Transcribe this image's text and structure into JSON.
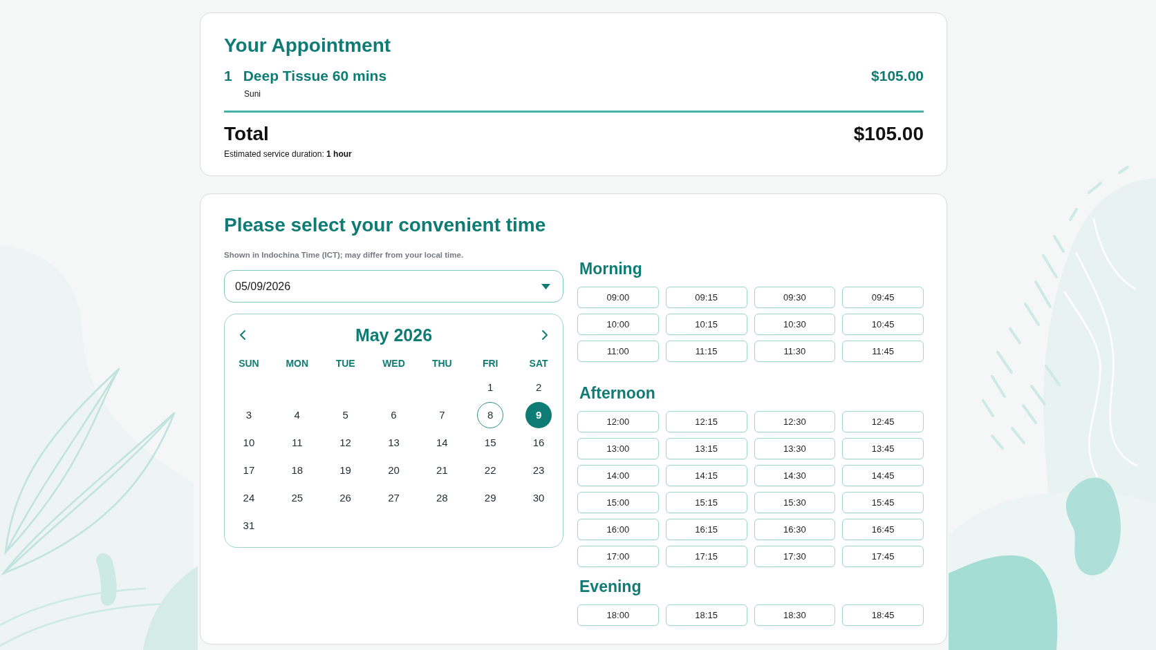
{
  "appointment": {
    "title": "Your Appointment",
    "items": [
      {
        "number": "1",
        "name": "Deep Tissue 60 mins",
        "staff": "Suni",
        "price": "$105.00"
      }
    ],
    "total": {
      "label": "Total",
      "amount": "$105.00",
      "duration_note": "Estimated service duration: **1 hour**"
    }
  },
  "booking": {
    "title": "Please select your convenient time",
    "timezone_note": "Shown in Indochina Time (ICT); may differ from your local time.",
    "date_field": {
      "value": "05/09/2026"
    },
    "calendar": {
      "month": "May 2026",
      "weekdays": [
        "SUN",
        "MON",
        "TUE",
        "WED",
        "THU",
        "FRI",
        "SAT"
      ],
      "weeks": [
        [
          {
            "day": "1",
            "selected": false,
            "today": false
          },
          {
            "day": "2",
            "selected": false,
            "today": false
          }
        ],
        [
          {
            "day": "3",
            "selected": false,
            "today": false
          },
          {
            "day": "4",
            "selected": false,
            "today": false
          },
          {
            "day": "5",
            "selected": false,
            "today": false
          },
          {
            "day": "6",
            "selected": false,
            "today": false
          },
          {
            "day": "7",
            "selected": false,
            "today": false
          },
          {
            "day": "8",
            "selected": false,
            "today": true
          },
          {
            "day": "9",
            "selected": true,
            "today": false
          }
        ],
        [
          {
            "day": "10",
            "selected": false,
            "today": false
          },
          {
            "day": "11",
            "selected": false,
            "today": false
          },
          {
            "day": "12",
            "selected": false,
            "today": false
          },
          {
            "day": "13",
            "selected": false,
            "today": false
          },
          {
            "day": "14",
            "selected": false,
            "today": false
          },
          {
            "day": "15",
            "selected": false,
            "today": false
          },
          {
            "day": "16",
            "selected": false,
            "today": false
          }
        ],
        [
          {
            "day": "17",
            "selected": false,
            "today": false
          },
          {
            "day": "18",
            "selected": false,
            "today": false
          },
          {
            "day": "19",
            "selected": false,
            "today": false
          },
          {
            "day": "20",
            "selected": false,
            "today": false
          },
          {
            "day": "21",
            "selected": false,
            "today": false
          },
          {
            "day": "22",
            "selected": false,
            "today": false
          },
          {
            "day": "23",
            "selected": false,
            "today": false
          }
        ],
        [
          {
            "day": "24",
            "selected": false,
            "today": false
          },
          {
            "day": "25",
            "selected": false,
            "today": false
          },
          {
            "day": "26",
            "selected": false,
            "today": false
          },
          {
            "day": "27",
            "selected": false,
            "today": false
          },
          {
            "day": "28",
            "selected": false,
            "today": false
          },
          {
            "day": "29",
            "selected": false,
            "today": false
          },
          {
            "day": "30",
            "selected": false,
            "today": false
          }
        ],
        [
          {
            "day": "31",
            "selected": false,
            "today": false
          }
        ]
      ]
    },
    "sessions": [
      {
        "title": "Morning",
        "slots": [
          {
            "time": "09:00",
            "selected": false
          },
          {
            "time": "09:15",
            "selected": false
          },
          {
            "time": "09:30",
            "selected": false
          },
          {
            "time": "09:45",
            "selected": false
          },
          {
            "time": "10:00",
            "selected": false
          },
          {
            "time": "10:15",
            "selected": false
          },
          {
            "time": "10:30",
            "selected": false
          },
          {
            "time": "10:45",
            "selected": false
          },
          {
            "time": "11:00",
            "selected": false
          },
          {
            "time": "11:15",
            "selected": false
          },
          {
            "time": "11:30",
            "selected": false
          },
          {
            "time": "11:45",
            "selected": false
          }
        ]
      },
      {
        "title": "Afternoon",
        "slots": [
          {
            "time": "12:00",
            "selected": false
          },
          {
            "time": "12:15",
            "selected": false
          },
          {
            "time": "12:30",
            "selected": false
          },
          {
            "time": "12:45",
            "selected": false
          },
          {
            "time": "13:00",
            "selected": false
          },
          {
            "time": "13:15",
            "selected": false
          },
          {
            "time": "13:30",
            "selected": false
          },
          {
            "time": "13:45",
            "selected": false
          },
          {
            "time": "14:00",
            "selected": false
          },
          {
            "time": "14:15",
            "selected": false
          },
          {
            "time": "14:30",
            "selected": false
          },
          {
            "time": "14:45",
            "selected": false
          },
          {
            "time": "15:00",
            "selected": false
          },
          {
            "time": "15:15",
            "selected": false
          },
          {
            "time": "15:30",
            "selected": false
          },
          {
            "time": "15:45",
            "selected": false
          },
          {
            "time": "16:00",
            "selected": false
          },
          {
            "time": "16:15",
            "selected": false
          },
          {
            "time": "16:30",
            "selected": false
          },
          {
            "time": "16:45",
            "selected": false
          },
          {
            "time": "17:00",
            "selected": false
          },
          {
            "time": "17:15",
            "selected": false
          },
          {
            "time": "17:30",
            "selected": false
          },
          {
            "time": "17:45",
            "selected": false
          }
        ]
      },
      {
        "title": "Evening",
        "slots": [
          {
            "time": "18:00",
            "selected": false
          },
          {
            "time": "18:15",
            "selected": false
          },
          {
            "time": "18:30",
            "selected": false
          },
          {
            "time": "18:45",
            "selected": false
          }
        ]
      }
    ]
  }
}
